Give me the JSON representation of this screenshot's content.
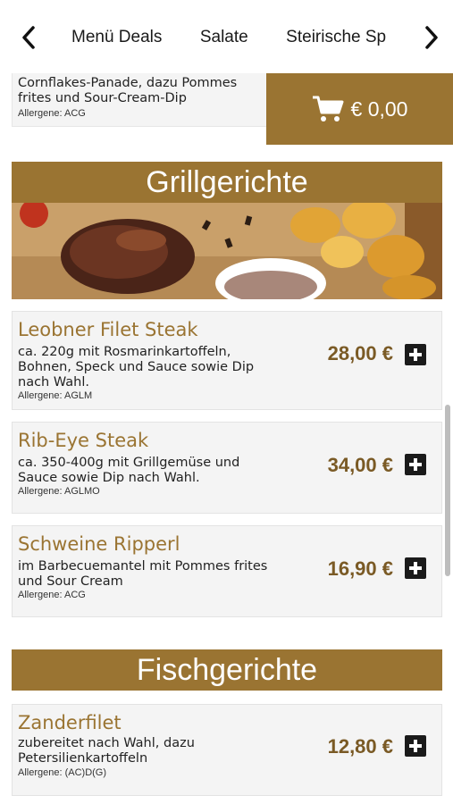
{
  "nav": {
    "tabs": [
      "Menü Deals",
      "Salate",
      "Steirische Sp"
    ]
  },
  "prev_item": {
    "description": "Cornflakes-Panade, dazu Pommes frites und Sour-Cream-Dip",
    "allergens": "Allergene: ACG"
  },
  "cart": {
    "total": "€ 0,00"
  },
  "sections": {
    "grill_title": "Grillgerichte",
    "fish_title": "Fischgerichte"
  },
  "items": [
    {
      "name": "Leobner Filet Steak",
      "description": "ca. 220g mit Rosmarinkartoffeln, Bohnen, Speck und Sauce sowie Dip nach Wahl.",
      "allergens": "Allergene: AGLM",
      "price": "28,00 €"
    },
    {
      "name": "Rib-Eye Steak",
      "description": "ca. 350-400g mit Grillgemüse und Sauce sowie Dip nach Wahl.",
      "allergens": "Allergene: AGLMO",
      "price": "34,00 €"
    },
    {
      "name": "Schweine Ripperl",
      "description": "im Barbecuemantel mit Pommes frites und Sour Cream",
      "allergens": "Allergene: ACG",
      "price": "16,90 €"
    },
    {
      "name": "Zanderfilet",
      "description": "zubereitet nach Wahl, dazu Petersilienkartoffeln",
      "allergens": "Allergene: (AC)D(G)",
      "price": "12,80 €"
    }
  ],
  "colors": {
    "accent": "#9a7432",
    "price": "#7a5a25",
    "card_bg": "#f4f4f4"
  },
  "icons": {
    "nav_left": "chevron-left-icon",
    "nav_right": "chevron-right-icon",
    "cart": "shopping-cart-icon",
    "add": "plus-square-icon"
  }
}
